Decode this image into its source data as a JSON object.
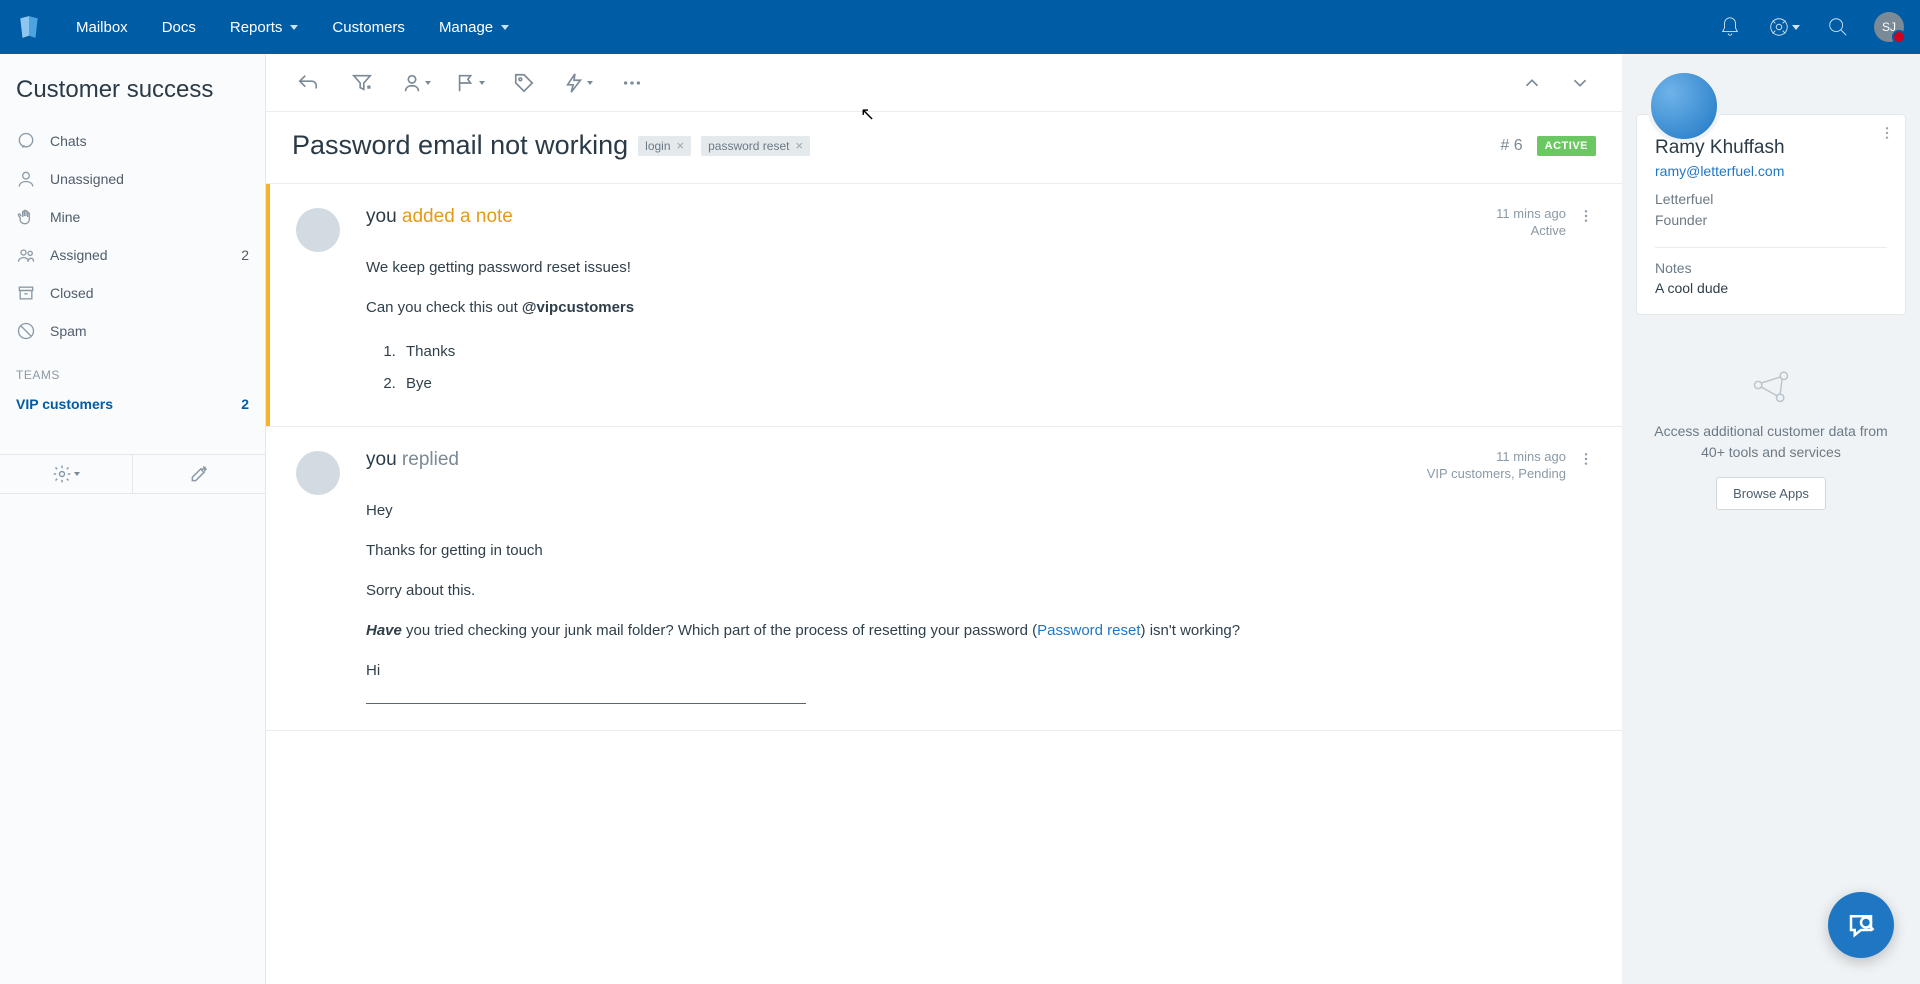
{
  "nav": {
    "items": [
      "Mailbox",
      "Docs",
      "Reports",
      "Customers",
      "Manage"
    ],
    "avatar_initials": "SJ"
  },
  "sidebar": {
    "title": "Customer success",
    "items": [
      {
        "label": "Chats"
      },
      {
        "label": "Unassigned"
      },
      {
        "label": "Mine"
      },
      {
        "label": "Assigned",
        "count": "2"
      },
      {
        "label": "Closed"
      },
      {
        "label": "Spam"
      }
    ],
    "section": "TEAMS",
    "team": {
      "name": "VIP customers",
      "count": "2"
    }
  },
  "conversation": {
    "subject": "Password email not working",
    "tags": [
      "login",
      "password reset"
    ],
    "number_prefix": "#",
    "number": "6",
    "status": "ACTIVE"
  },
  "thread": [
    {
      "who": "you",
      "action": "added a note",
      "time": "11 mins ago",
      "status": "Active",
      "body_p1": "We keep getting password reset issues!",
      "body_p2_a": "Can you check this out ",
      "body_p2_b": "@vipcustomers",
      "list": [
        "Thanks",
        "Bye"
      ]
    },
    {
      "who": "you",
      "action": "replied",
      "time": "11 mins ago",
      "status": "VIP customers, Pending",
      "p1": "Hey",
      "p2": "Thanks for getting in touch",
      "p3": "Sorry about this.",
      "p4_strong": "Have",
      "p4_a": " you tried checking your junk mail folder? Which part of the process of resetting your password (",
      "p4_link": "Password reset",
      "p4_b": ") isn't working?",
      "p5": "Hi"
    }
  ],
  "customer": {
    "name": "Ramy Khuffash",
    "email": "ramy@letterfuel.com",
    "company": "Letterfuel",
    "role": "Founder",
    "notes_label": "Notes",
    "notes": "A cool dude"
  },
  "apps": {
    "text": "Access additional customer data from 40+ tools and services",
    "button": "Browse Apps"
  }
}
